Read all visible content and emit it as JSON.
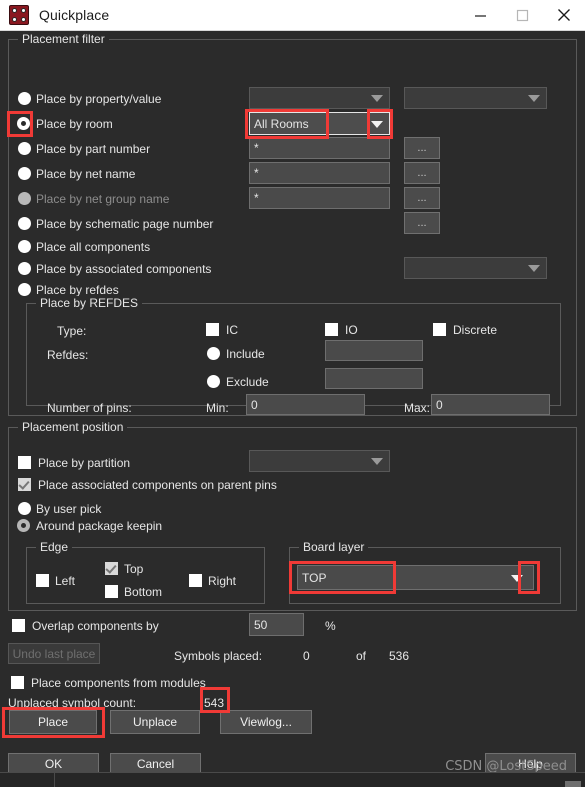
{
  "window": {
    "title": "Quickplace",
    "icon": "quickplace-app-icon",
    "controls": {
      "minimize": "minimize",
      "maximize": "maximize",
      "close": "close"
    }
  },
  "placement_filter": {
    "legend": "Placement filter",
    "options": [
      {
        "label": "Place by property/value",
        "selected": false,
        "disabled": false
      },
      {
        "label": "Place by room",
        "selected": true,
        "disabled": false
      },
      {
        "label": "Place by part number",
        "selected": false,
        "disabled": false
      },
      {
        "label": "Place by net name",
        "selected": false,
        "disabled": false
      },
      {
        "label": "Place by net group name",
        "selected": false,
        "disabled": true
      },
      {
        "label": "Place by schematic page number",
        "selected": false,
        "disabled": false
      },
      {
        "label": "Place all components",
        "selected": false,
        "disabled": false
      },
      {
        "label": "Place by associated components",
        "selected": false,
        "disabled": false
      },
      {
        "label": "Place by refdes",
        "selected": false,
        "disabled": false
      }
    ],
    "property_combo": {
      "value": "",
      "placeholder": ""
    },
    "property_value_combo": {
      "value": "",
      "placeholder": ""
    },
    "room_combo": {
      "value": "All Rooms"
    },
    "part_number_field": {
      "value": "*"
    },
    "net_name_field": {
      "value": "*"
    },
    "net_group_name_field": {
      "value": "*"
    },
    "browse_button_label": "...",
    "associated_components_combo": {
      "value": ""
    }
  },
  "refdes_group": {
    "legend": "Place by REFDES",
    "type_label": "Type:",
    "type_checkboxes": [
      {
        "label": "IC",
        "checked": false
      },
      {
        "label": "IO",
        "checked": false
      },
      {
        "label": "Discrete",
        "checked": false
      }
    ],
    "refdes_label": "Refdes:",
    "include_label": "Include",
    "exclude_label": "Exclude",
    "include_value": "",
    "exclude_value": "",
    "pins_label": "Number of pins:",
    "min_label": "Min:",
    "min_value": "0",
    "max_label": "Max:",
    "max_value": "0"
  },
  "placement_position": {
    "legend": "Placement position",
    "place_by_partition": {
      "label": "Place by partition",
      "checked": false
    },
    "partition_combo": {
      "value": ""
    },
    "place_assoc_parent_pins": {
      "label": "Place associated components on parent pins",
      "checked": true
    },
    "by_user_pick": {
      "label": "By user pick",
      "selected": false
    },
    "around_package_keepin": {
      "label": "Around package keepin",
      "selected": true
    }
  },
  "edge_group": {
    "legend": "Edge",
    "left": {
      "label": "Left",
      "checked": false
    },
    "top": {
      "label": "Top",
      "checked": true
    },
    "bottom": {
      "label": "Bottom",
      "checked": false
    },
    "right": {
      "label": "Right",
      "checked": false
    }
  },
  "board_layer_group": {
    "legend": "Board layer",
    "value": "TOP"
  },
  "overlap": {
    "label": "Overlap components by",
    "checked": false,
    "value": "50",
    "unit": "%"
  },
  "status": {
    "undo_button": "Undo last place",
    "symbols_placed_label": "Symbols placed:",
    "symbols_placed_count": "0",
    "of_label": "of",
    "symbols_total": "536",
    "place_from_modules": {
      "label": "Place components from modules",
      "checked": false
    },
    "unplaced_label": "Unplaced symbol count:",
    "unplaced_count": "543"
  },
  "action_buttons": {
    "place": "Place",
    "unplace": "Unplace",
    "viewlog": "Viewlog..."
  },
  "dialog_buttons": {
    "ok": "OK",
    "cancel": "Cancel",
    "help": "Help"
  },
  "watermark": "CSDN @LostSpeed",
  "colors": {
    "annotation": "#f03a36",
    "dialog_bg": "#2b2b2b",
    "titlebar_bg": "#ffffff",
    "field_bg": "#4a4a4a",
    "accent_icon": "#8a1820"
  }
}
